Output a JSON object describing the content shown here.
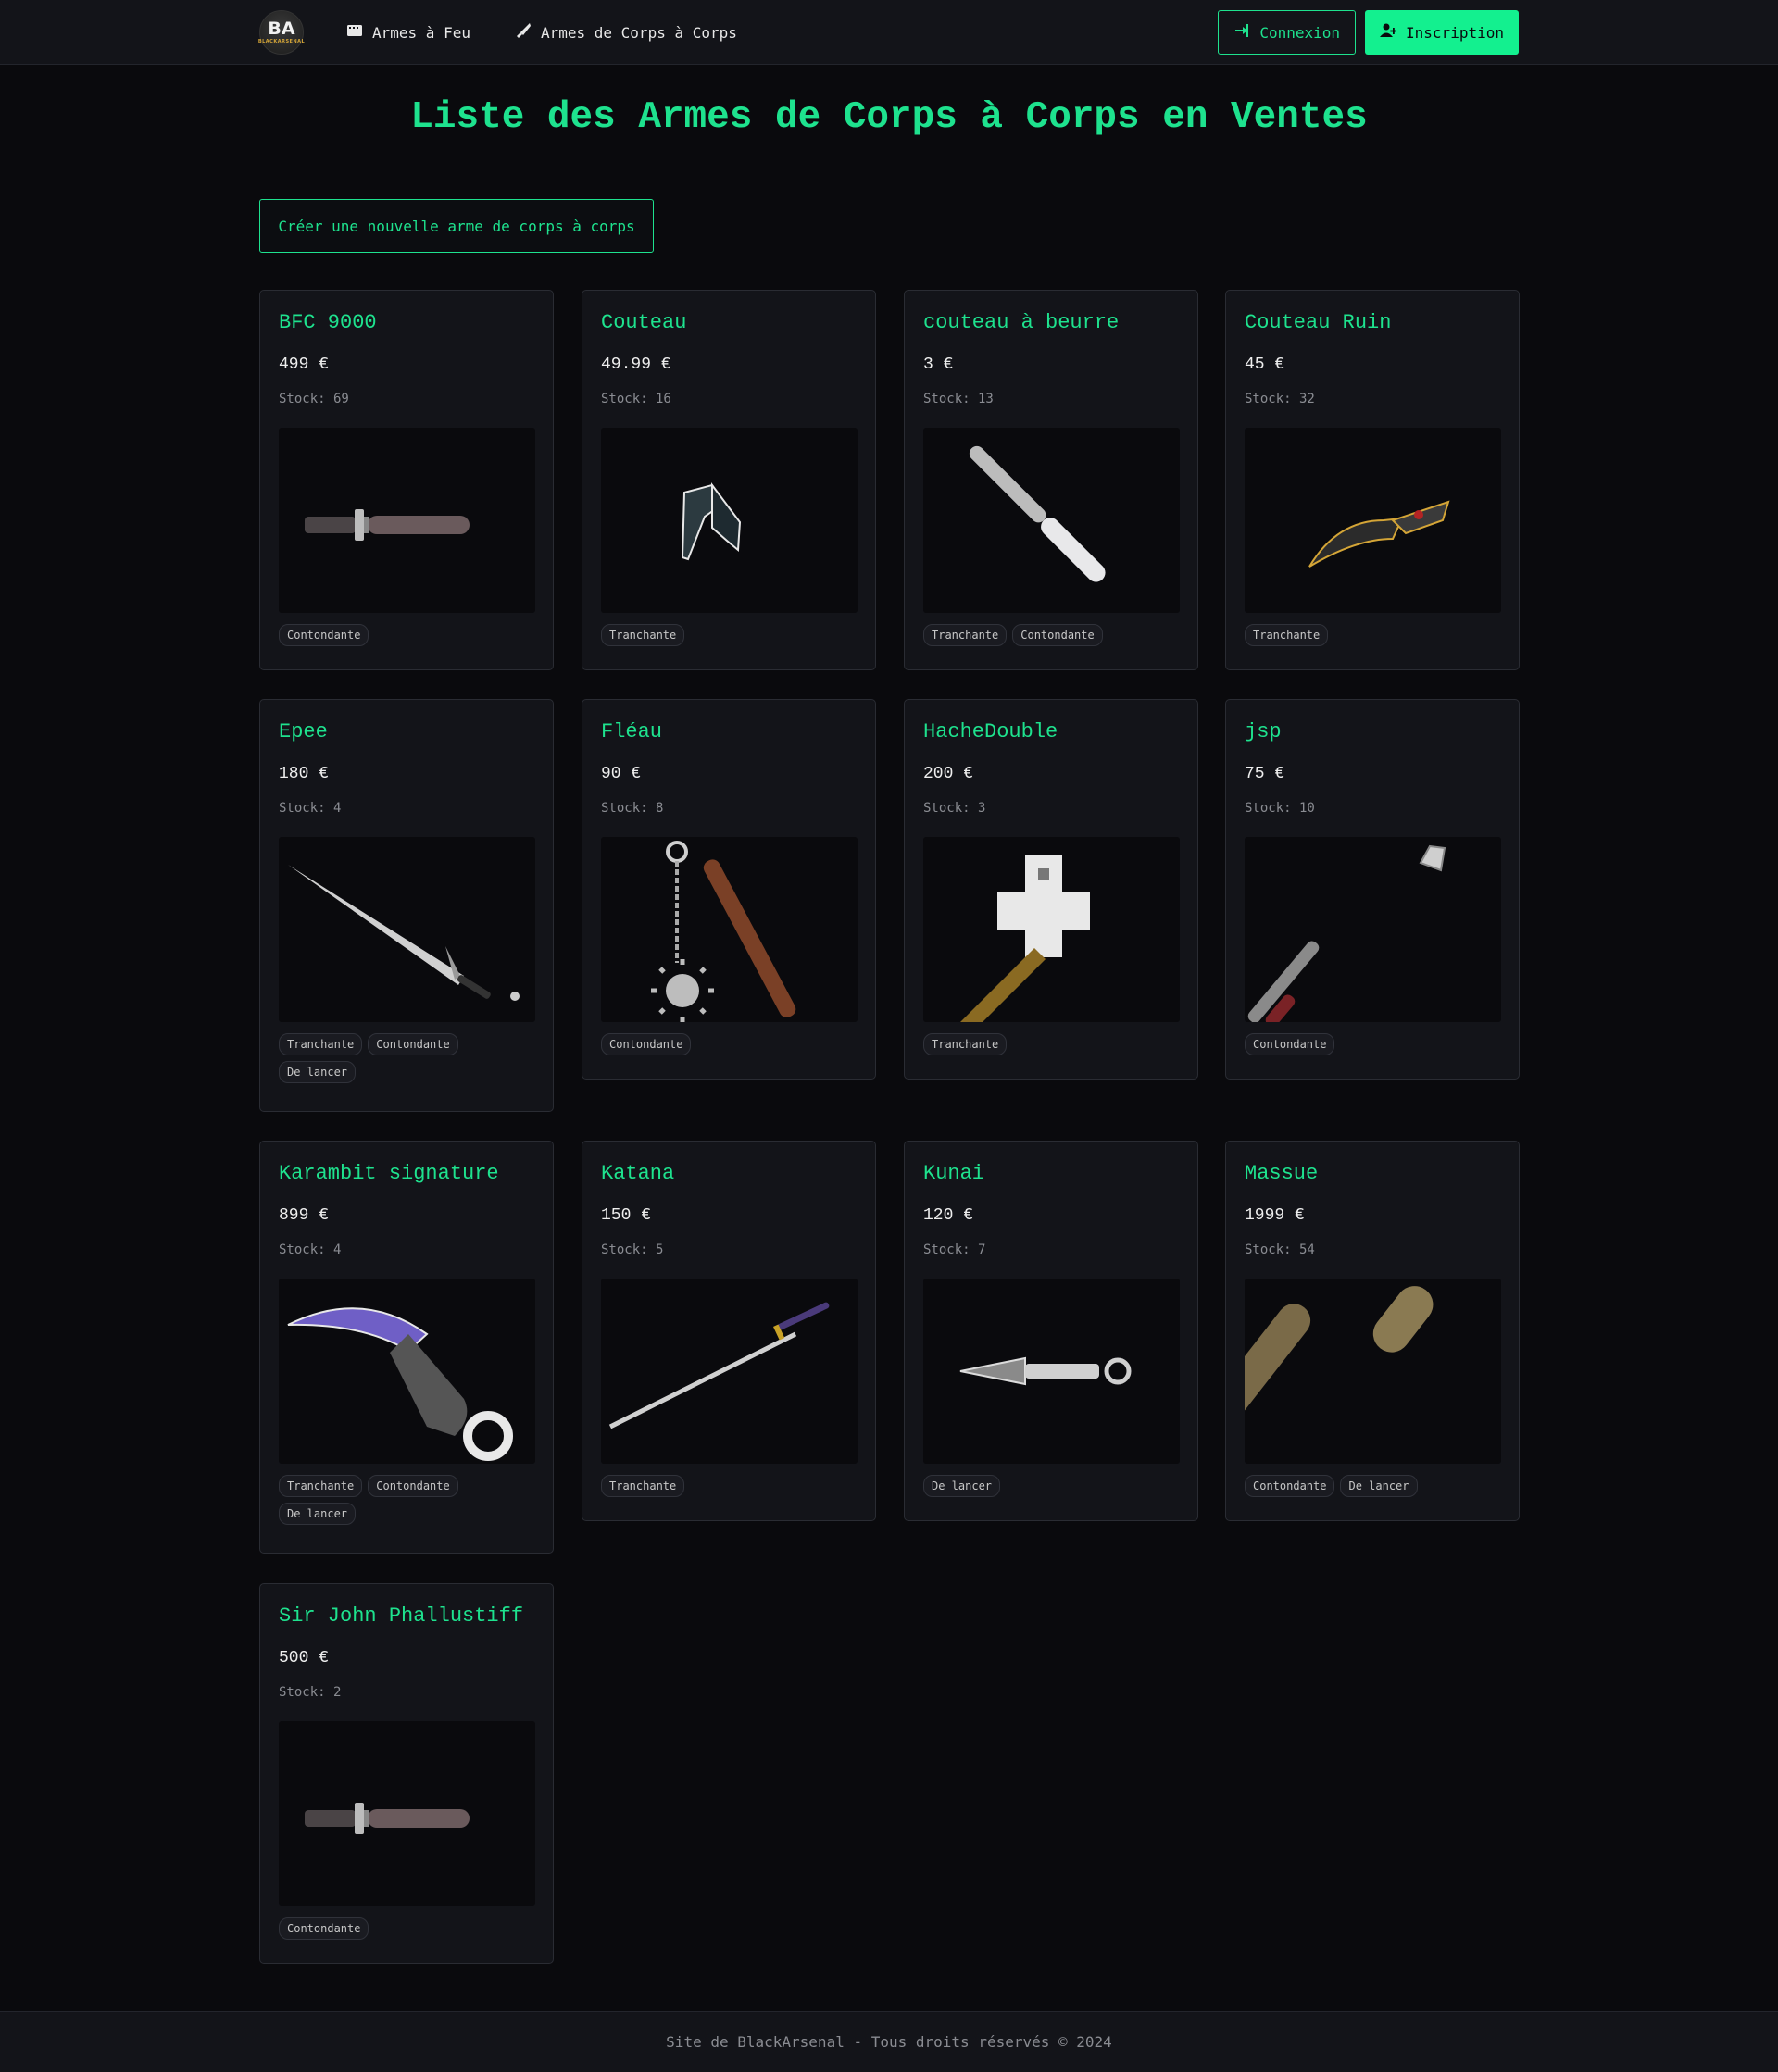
{
  "nav": {
    "logo_text": "BA",
    "logo_sub": "BLACKARSENAL",
    "links": [
      {
        "label": "Armes à Feu"
      },
      {
        "label": "Armes de Corps à Corps"
      }
    ],
    "login_label": "Connexion",
    "signup_label": "Inscription"
  },
  "page": {
    "title": "Liste des Armes de Corps à Corps en Ventes",
    "create_label": "Créer une nouvelle arme de corps à corps"
  },
  "weapons": [
    {
      "name": "BFC 9000",
      "price": "499 €",
      "stock": "Stock: 69",
      "tags": [
        "Contondante"
      ],
      "icon": "dagger-icon"
    },
    {
      "name": "Couteau",
      "price": "49.99 €",
      "stock": "Stock: 16",
      "tags": [
        "Tranchante"
      ],
      "icon": "folding-knife-icon"
    },
    {
      "name": "couteau à beurre",
      "price": "3 €",
      "stock": "Stock: 13",
      "tags": [
        "Tranchante",
        "Contondante"
      ],
      "icon": "butter-knife-icon"
    },
    {
      "name": "Couteau Ruin",
      "price": "45 €",
      "stock": "Stock: 32",
      "tags": [
        "Tranchante"
      ],
      "icon": "curved-knife-icon"
    },
    {
      "name": "Epee",
      "price": "180 €",
      "stock": "Stock: 4",
      "tags": [
        "Tranchante",
        "Contondante",
        "De lancer"
      ],
      "icon": "sword-icon"
    },
    {
      "name": "Fléau",
      "price": "90 €",
      "stock": "Stock: 8",
      "tags": [
        "Contondante"
      ],
      "icon": "flail-icon"
    },
    {
      "name": "HacheDouble",
      "price": "200 €",
      "stock": "Stock: 3",
      "tags": [
        "Tranchante"
      ],
      "icon": "double-axe-icon"
    },
    {
      "name": "jsp",
      "price": "75 €",
      "stock": "Stock: 10",
      "tags": [
        "Contondante"
      ],
      "icon": "mace-icon"
    },
    {
      "name": "Karambit signature",
      "price": "899 €",
      "stock": "Stock: 4",
      "tags": [
        "Tranchante",
        "Contondante",
        "De lancer"
      ],
      "icon": "karambit-icon"
    },
    {
      "name": "Katana",
      "price": "150 €",
      "stock": "Stock: 5",
      "tags": [
        "Tranchante"
      ],
      "icon": "katana-icon"
    },
    {
      "name": "Kunai",
      "price": "120 €",
      "stock": "Stock: 7",
      "tags": [
        "De lancer"
      ],
      "icon": "kunai-icon"
    },
    {
      "name": "Massue",
      "price": "1999 €",
      "stock": "Stock: 54",
      "tags": [
        "Contondante",
        "De lancer"
      ],
      "icon": "club-icon"
    },
    {
      "name": "Sir John Phallustiff",
      "price": "500 €",
      "stock": "Stock: 2",
      "tags": [
        "Contondante"
      ],
      "icon": "dagger-icon"
    }
  ],
  "footer": {
    "text": "Site de BlackArsenal - Tous droits réservés © 2024"
  },
  "colors": {
    "accent": "#1ee28e",
    "accent_fill": "#13f08f",
    "background": "#0a0a0d",
    "card": "#131419"
  }
}
